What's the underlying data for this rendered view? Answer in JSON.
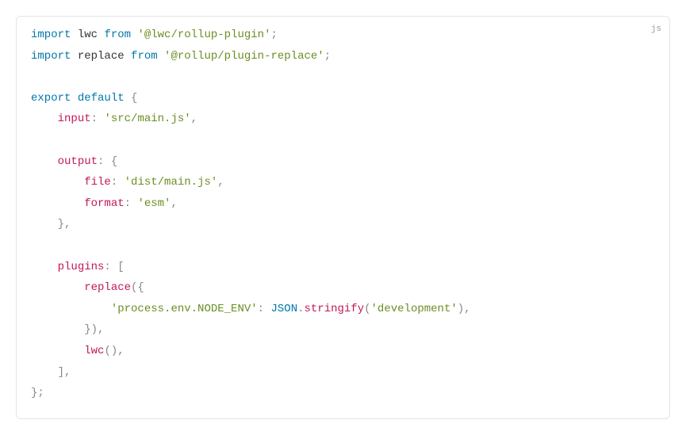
{
  "lang_label": "js",
  "code": {
    "line1_kw1": "import",
    "line1_ident": " lwc ",
    "line1_kw2": "from",
    "line1_str": " '@lwc/rollup-plugin'",
    "line1_semi": ";",
    "line2_kw1": "import",
    "line2_ident": " replace ",
    "line2_kw2": "from",
    "line2_str": " '@rollup/plugin-replace'",
    "line2_semi": ";",
    "line4_kw1": "export",
    "line4_kw2": " default",
    "line4_brace": " {",
    "line5_indent": "    ",
    "line5_attr": "input",
    "line5_colon": ": ",
    "line5_str": "'src/main.js'",
    "line5_comma": ",",
    "line7_indent": "    ",
    "line7_attr": "output",
    "line7_colon": ": ",
    "line7_brace": "{",
    "line8_indent": "        ",
    "line8_attr": "file",
    "line8_colon": ": ",
    "line8_str": "'dist/main.js'",
    "line8_comma": ",",
    "line9_indent": "        ",
    "line9_attr": "format",
    "line9_colon": ": ",
    "line9_str": "'esm'",
    "line9_comma": ",",
    "line10_indent": "    ",
    "line10_brace": "},",
    "line12_indent": "    ",
    "line12_attr": "plugins",
    "line12_colon": ": ",
    "line12_bracket": "[",
    "line13_indent": "        ",
    "line13_fn": "replace",
    "line13_paren": "({",
    "line14_indent": "            ",
    "line14_str1": "'process.env.NODE_ENV'",
    "line14_colon": ": ",
    "line14_cls": "JSON",
    "line14_dot": ".",
    "line14_method": "stringify",
    "line14_paren1": "(",
    "line14_str2": "'development'",
    "line14_paren2": "),",
    "line15_indent": "        ",
    "line15_close": "}),",
    "line16_indent": "        ",
    "line16_fn": "lwc",
    "line16_paren": "(),",
    "line17_indent": "    ",
    "line17_bracket": "],",
    "line18_close": "};"
  }
}
